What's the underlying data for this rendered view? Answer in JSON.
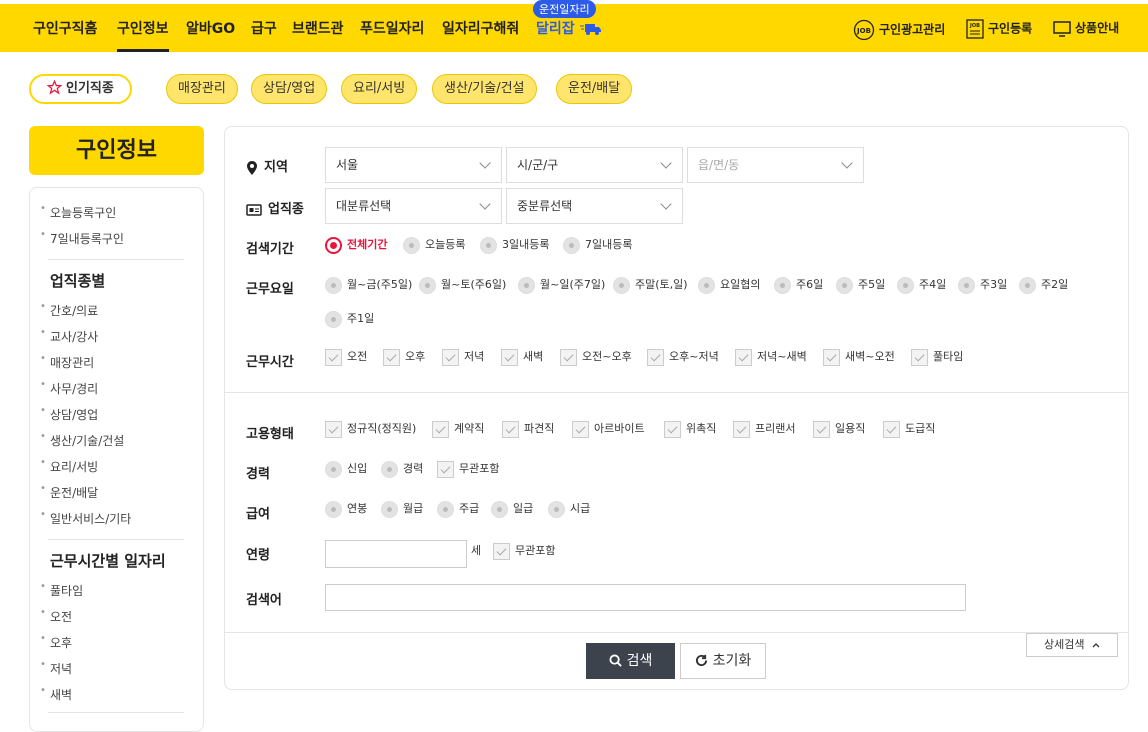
{
  "nav": {
    "items": [
      "구인구직홈",
      "구인정보",
      "알바GO",
      "급구",
      "브랜드관",
      "푸드일자리",
      "일자리구해줘",
      "달리잡"
    ],
    "badge": "운전일자리",
    "right": [
      "구인광고관리",
      "구인등록",
      "상품안내"
    ]
  },
  "chips": {
    "main": "인기직종",
    "items": [
      "매장관리",
      "상담/영업",
      "요리/서빙",
      "생산/기술/건설",
      "운전/배달"
    ]
  },
  "sidebar": {
    "title": "구인정보",
    "top_links": [
      "오늘등록구인",
      "7일내등록구인"
    ],
    "section1": "업직종별",
    "section1_items": [
      "간호/의료",
      "교사/강사",
      "매장관리",
      "사무/경리",
      "상담/영업",
      "생산/기술/건설",
      "요리/서빙",
      "운전/배달",
      "일반서비스/기타"
    ],
    "section2": "근무시간별 일자리",
    "section2_items": [
      "풀타임",
      "오전",
      "오후",
      "저녁",
      "새벽"
    ]
  },
  "form": {
    "region_label": "지역",
    "region_selects": [
      "서울",
      "시/군/구",
      "읍/면/동"
    ],
    "job_label": "업직종",
    "job_selects": [
      "대분류선택",
      "중분류선택"
    ],
    "period_label": "검색기간",
    "period_options": [
      "전체기간",
      "오늘등록",
      "3일내등록",
      "7일내등록"
    ],
    "period_selected": "전체기간",
    "days_label": "근무요일",
    "days_options": [
      "월~금(주5일)",
      "월~토(주6일)",
      "월~일(주7일)",
      "주말(토,일)",
      "요일협의",
      "주6일",
      "주5일",
      "주4일",
      "주3일",
      "주2일",
      "주1일"
    ],
    "time_label": "근무시간",
    "time_options": [
      "오전",
      "오후",
      "저녁",
      "새벽",
      "오전~오후",
      "오후~저녁",
      "저녁~새벽",
      "새벽~오전",
      "풀타임"
    ],
    "emp_label": "고용형태",
    "emp_options": [
      "정규직(정직원)",
      "계약직",
      "파견직",
      "아르바이트",
      "위촉직",
      "프리랜서",
      "일용직",
      "도급직"
    ],
    "career_label": "경력",
    "career_radios": [
      "신입",
      "경력"
    ],
    "career_check": "무관포함",
    "pay_label": "급여",
    "pay_options": [
      "연봉",
      "월급",
      "주급",
      "일급",
      "시급"
    ],
    "age_label": "연령",
    "age_unit": "세",
    "age_check": "무관포함",
    "keyword_label": "검색어",
    "search_button": "검색",
    "reset_button": "초기화",
    "detail_button": "상세검색"
  },
  "colors": {
    "brand_yellow": "#ffd800",
    "accent_red": "#e8163d",
    "accent_blue": "#2c5be8",
    "button_dark": "#3c434d"
  }
}
